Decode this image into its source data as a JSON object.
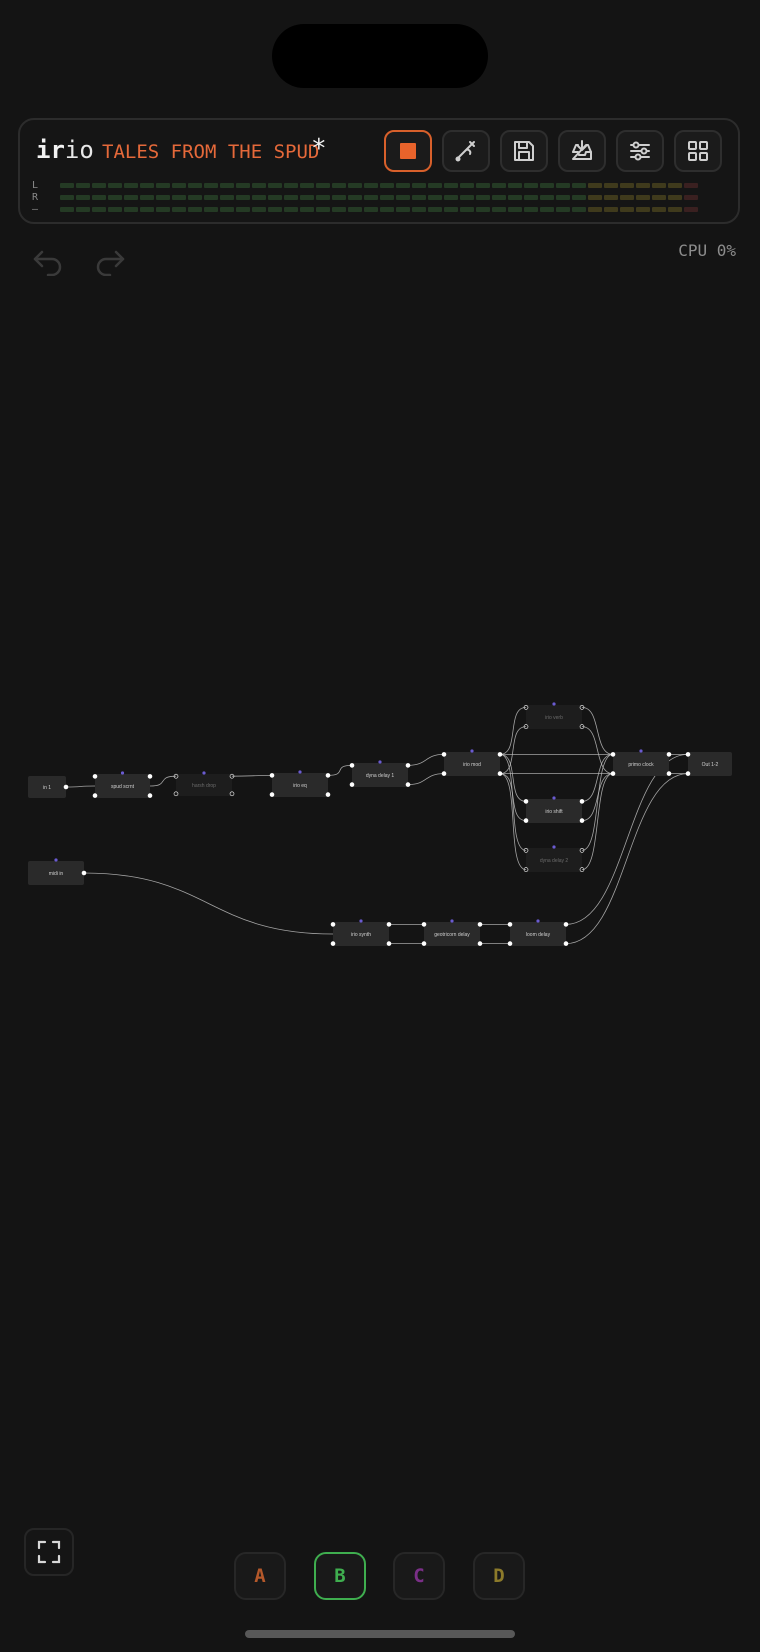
{
  "app": {
    "logo_bold": "ir",
    "logo_light": "io",
    "preset_name": "TALES FROM THE SPUD",
    "unsaved_marker": "*"
  },
  "toolbar": {
    "buttons": [
      {
        "name": "stop",
        "icon": "stop-icon"
      },
      {
        "name": "tuner",
        "icon": "tuning-fork-icon"
      },
      {
        "name": "save",
        "icon": "save-icon"
      },
      {
        "name": "load",
        "icon": "inbox-download-icon"
      },
      {
        "name": "settings",
        "icon": "sliders-icon"
      },
      {
        "name": "grid",
        "icon": "grid-icon"
      }
    ]
  },
  "meters": {
    "labels": [
      "L",
      "R",
      "—"
    ],
    "colors": {
      "low": "#243a24",
      "mid": "#3f3a1c",
      "high": "#3a2020"
    }
  },
  "cpu": {
    "label": "CPU",
    "value": "0%"
  },
  "history": {
    "undo_icon": "undo-icon",
    "redo_icon": "redo-icon"
  },
  "graph": {
    "nodes": [
      {
        "id": "in",
        "label": "in 1",
        "bypassed": false
      },
      {
        "id": "spud",
        "label": "spud scrnt",
        "bypassed": false
      },
      {
        "id": "harsh",
        "label": "harsh drop",
        "bypassed": true
      },
      {
        "id": "eq",
        "label": "irio eq",
        "bypassed": false
      },
      {
        "id": "dyna1",
        "label": "dyna delay 1",
        "bypassed": false
      },
      {
        "id": "mod",
        "label": "irio mod",
        "bypassed": false
      },
      {
        "id": "verb",
        "label": "irio verb",
        "bypassed": true
      },
      {
        "id": "shift",
        "label": "irio shift",
        "bypassed": false
      },
      {
        "id": "dyna2",
        "label": "dyna delay 2",
        "bypassed": true
      },
      {
        "id": "primo",
        "label": "primo clock",
        "bypassed": false
      },
      {
        "id": "out",
        "label": "Out 1-2",
        "bypassed": false
      },
      {
        "id": "midi",
        "label": "midi in",
        "bypassed": false
      },
      {
        "id": "synth",
        "label": "irio synth",
        "bypassed": false
      },
      {
        "id": "geo",
        "label": "geotricorn delay",
        "bypassed": false
      },
      {
        "id": "loom",
        "label": "loom delay",
        "bypassed": false
      }
    ],
    "colors": {
      "node": "#2a2a2a",
      "port": "#ffffff",
      "param": "#6a5bd0",
      "wire": "#bdbdbd"
    }
  },
  "scenes": [
    {
      "label": "A",
      "color": "#b4582a",
      "active": false
    },
    {
      "label": "B",
      "color": "#3fae4f",
      "active": true
    },
    {
      "label": "C",
      "color": "#7a2f87",
      "active": false
    },
    {
      "label": "D",
      "color": "#8c7a2a",
      "active": false
    }
  ],
  "fullscreen": {
    "icon": "fullscreen-icon"
  }
}
